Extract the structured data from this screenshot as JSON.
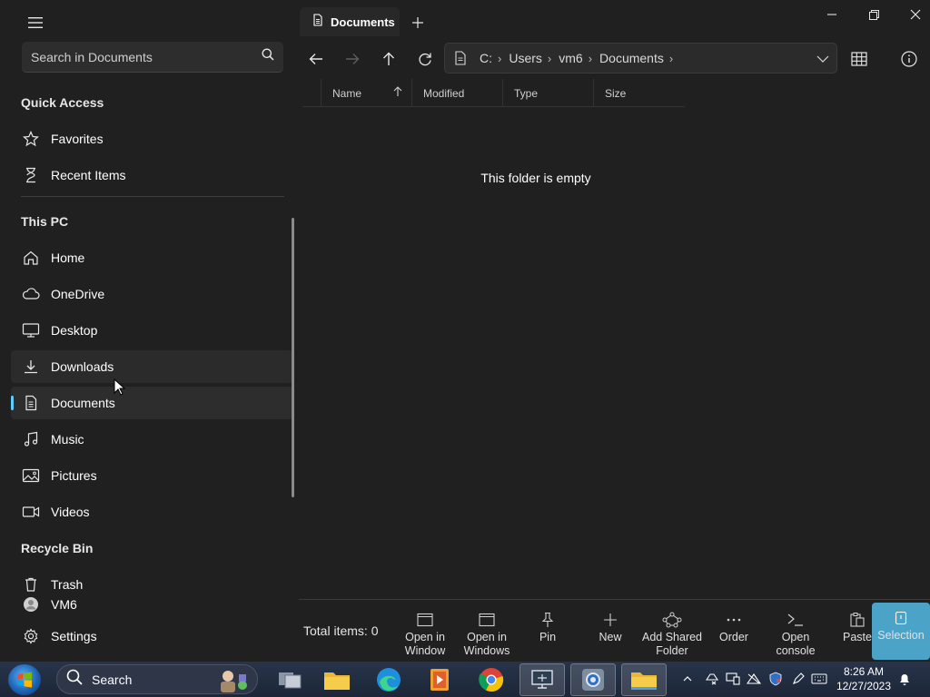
{
  "tab": {
    "title": "Documents",
    "add_icon": "plus-icon"
  },
  "window_controls": [
    "minimize-icon",
    "restore-icon",
    "close-icon"
  ],
  "sidebar": {
    "search_placeholder": "Search in Documents",
    "quick_access_title": "Quick Access",
    "quick_access": [
      {
        "label": "Favorites",
        "icon": "star-icon"
      },
      {
        "label": "Recent Items",
        "icon": "hourglass-icon"
      }
    ],
    "this_pc_title": "This PC",
    "this_pc": [
      {
        "label": "Home",
        "icon": "home-icon"
      },
      {
        "label": "OneDrive",
        "icon": "cloud-icon"
      },
      {
        "label": "Desktop",
        "icon": "monitor-icon"
      },
      {
        "label": "Downloads",
        "icon": "download-icon"
      },
      {
        "label": "Documents",
        "icon": "document-icon"
      },
      {
        "label": "Music",
        "icon": "music-icon"
      },
      {
        "label": "Pictures",
        "icon": "image-icon"
      },
      {
        "label": "Videos",
        "icon": "video-icon"
      }
    ],
    "recycle_title": "Recycle Bin",
    "trash_label": "Trash",
    "user_label": "VM6",
    "settings_label": "Settings"
  },
  "address": {
    "crumbs": [
      "C:",
      "Users",
      "vm6",
      "Documents"
    ]
  },
  "columns": [
    "Name",
    "Modified",
    "Type",
    "Size"
  ],
  "empty_message": "This folder is empty",
  "status": {
    "total": "Total items: 0"
  },
  "commands": [
    {
      "line1": "Open in",
      "line2": "Window",
      "icon": "window-icon"
    },
    {
      "line1": "Open in",
      "line2": "Windows",
      "icon": "window-icon"
    },
    {
      "line1": "Pin",
      "line2": "",
      "icon": "pin-icon"
    },
    {
      "line1": "New",
      "line2": "",
      "icon": "plus-icon"
    },
    {
      "line1": "Add Shared",
      "line2": "Folder",
      "icon": "share-network-icon"
    },
    {
      "line1": "Order",
      "line2": "",
      "icon": "more-icon"
    },
    {
      "line1": "Open",
      "line2": "console",
      "icon": "terminal-icon"
    },
    {
      "line1": "Paste",
      "line2": "",
      "icon": "paste-icon"
    },
    {
      "line1": "Selection",
      "line2": "",
      "icon": "selection-icon"
    }
  ],
  "taskbar": {
    "search_label": "Search",
    "time": "8:26 AM",
    "date": "12/27/2023"
  }
}
